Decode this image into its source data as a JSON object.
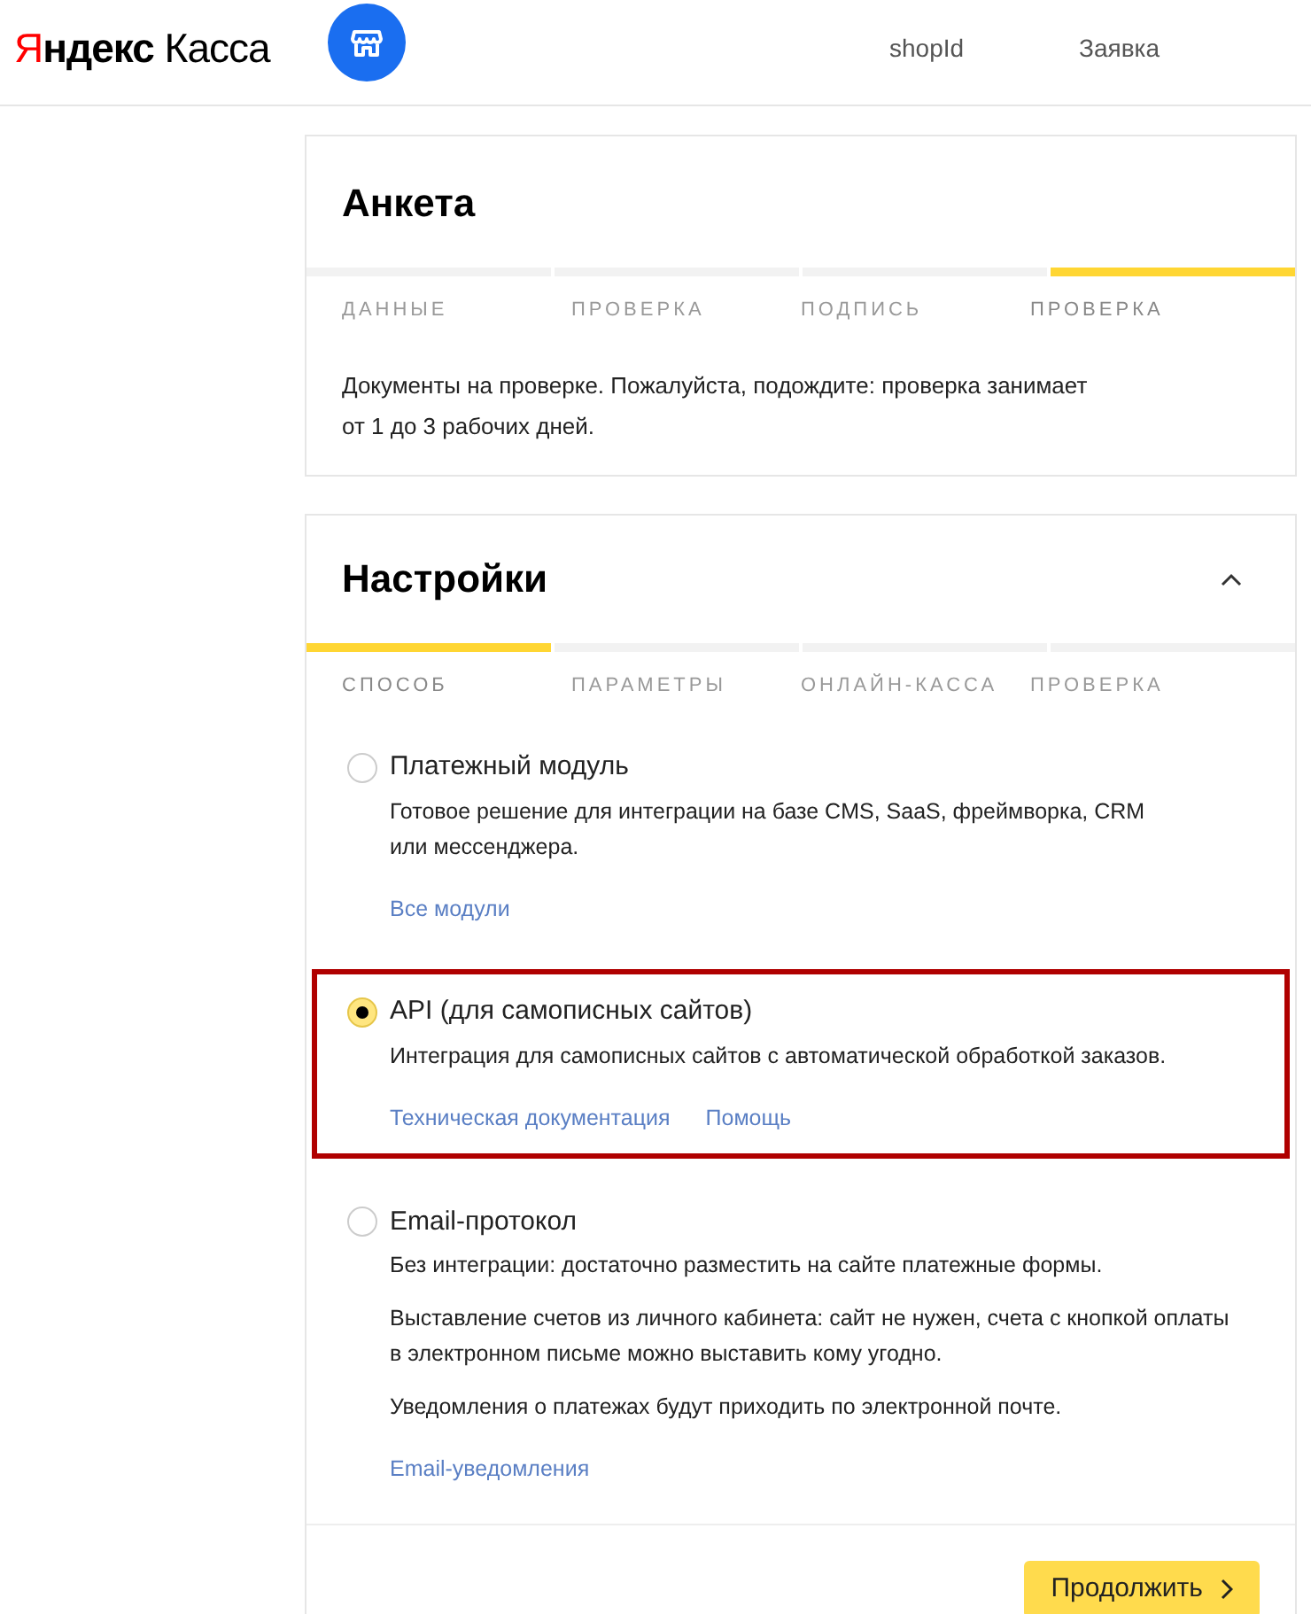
{
  "header": {
    "logo": {
      "accent": "Я",
      "rest": "ндекс",
      "product": "Касса"
    },
    "nav": [
      "shopId",
      "Заявка"
    ]
  },
  "questionnaire": {
    "title": "Анкета",
    "steps": [
      {
        "label": "ДАННЫЕ",
        "selected": false
      },
      {
        "label": "ПРОВЕРКА",
        "selected": false
      },
      {
        "label": "ПОДПИСЬ",
        "selected": false
      },
      {
        "label": "ПРОВЕРКА",
        "selected": true
      }
    ],
    "message": "Документы на проверке. Пожалуйста, подождите: проверка занимает\nот 1 до 3 рабочих дней."
  },
  "settings": {
    "title": "Настройки",
    "expanded": true,
    "steps": [
      {
        "label": "СПОСОБ",
        "selected": true
      },
      {
        "label": "ПАРАМЕТРЫ",
        "selected": false
      },
      {
        "label": "ОНЛАЙН-КАССА",
        "selected": false
      },
      {
        "label": "ПРОВЕРКА",
        "selected": false
      }
    ],
    "options": [
      {
        "label": "Платежный модуль",
        "selected": false,
        "highlighted": false,
        "descriptions": [
          "Готовое решение для интеграции на базе CMS, SaaS, фреймворка, CRM\nили мессенджера."
        ],
        "links": [
          "Все модули"
        ]
      },
      {
        "label": "API (для самописных сайтов)",
        "selected": true,
        "highlighted": true,
        "descriptions": [
          "Интеграция для самописных сайтов с автоматической обработкой заказов."
        ],
        "links": [
          "Техническая документация",
          "Помощь"
        ]
      },
      {
        "label": "Email-протокол",
        "selected": false,
        "highlighted": false,
        "descriptions": [
          "Без интеграции: достаточно разместить на сайте платежные формы.",
          "Выставление счетов из личного кабинета: сайт не нужен, счета с кнопкой оплаты\nв электронном письме можно выставить кому угодно.",
          "Уведомления о платежах будут приходить по электронной почте."
        ],
        "links": [
          "Email-уведомления"
        ]
      }
    ],
    "continue_button": "Продолжить"
  }
}
